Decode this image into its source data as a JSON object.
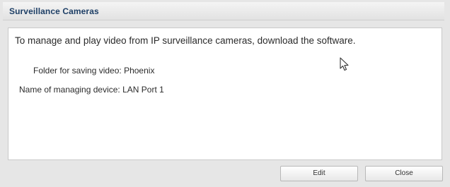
{
  "dialog": {
    "title": "Surveillance Cameras",
    "intro": "To manage and play video from IP surveillance cameras, download the software.",
    "fields": [
      {
        "label": "Folder for saving video:",
        "value": "Phoenix"
      },
      {
        "label": "Name of managing device:",
        "value": "LAN Port 1"
      }
    ],
    "buttons": {
      "edit_label": "Edit",
      "close_label": "Close"
    }
  },
  "icons": {
    "cursor": "mouse-pointer-icon"
  },
  "colors": {
    "title_text": "#1e3f66",
    "content_bg": "#ffffff",
    "frame_bg": "#e6e6e6"
  }
}
